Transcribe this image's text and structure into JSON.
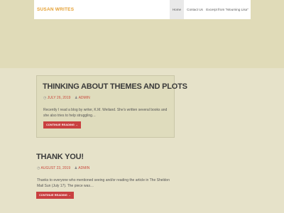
{
  "site": {
    "brand": "SUSAN WRITES",
    "nav": [
      {
        "label": "Home"
      },
      {
        "label": "Contact Us"
      },
      {
        "label": "Excerpt from \"Mourning Lisa\""
      }
    ]
  },
  "posts": [
    {
      "title": "THINKING ABOUT THEMES AND PLOTS",
      "date": "JULY 26, 2019",
      "author": "ADMIN",
      "excerpt": "Recently I read a blog by writer, K.M. Weiland. She's written several books and she also tries to help struggling…",
      "button": "CONTINUE READING →"
    },
    {
      "title": "THANK YOU!",
      "date": "AUGUST 23, 2019",
      "author": "ADMIN",
      "excerpt": "Thanks to everyone who mentioned seeing and/or reading the article in The Sheldon Mail Sun (July 17). The piece was…",
      "button": "CONTINUE READING →"
    }
  ]
}
